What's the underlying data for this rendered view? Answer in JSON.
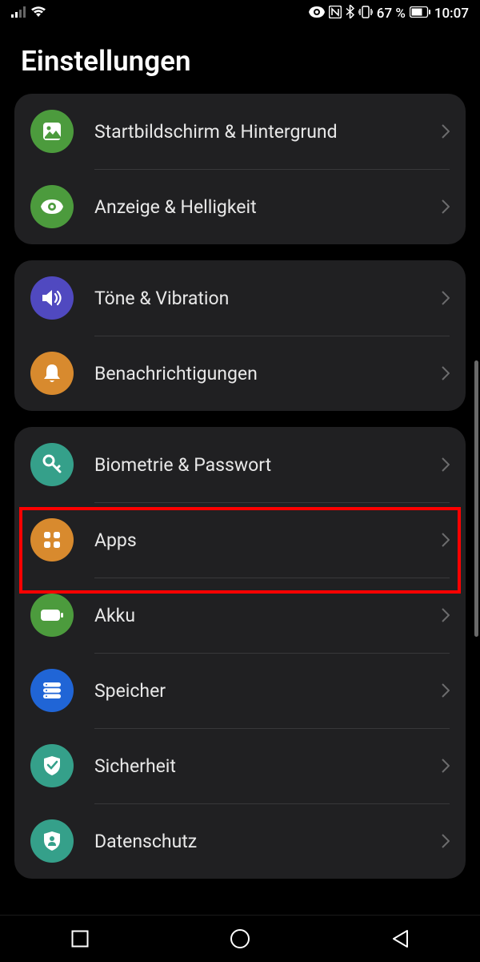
{
  "status": {
    "battery_text": "67 %",
    "time": "10:07"
  },
  "title": "Einstellungen",
  "groups": [
    {
      "items": [
        {
          "id": "home",
          "label": "Startbildschirm & Hintergrund",
          "icon": "image-icon",
          "color": "#4c9b3d"
        },
        {
          "id": "display",
          "label": "Anzeige & Helligkeit",
          "icon": "eye-icon",
          "color": "#4c9b3d"
        }
      ]
    },
    {
      "items": [
        {
          "id": "sound",
          "label": "Töne & Vibration",
          "icon": "volume-icon",
          "color": "#5049c0"
        },
        {
          "id": "notifications",
          "label": "Benachrichtigungen",
          "icon": "bell-icon",
          "color": "#d88a2e"
        }
      ]
    },
    {
      "items": [
        {
          "id": "biometrics",
          "label": "Biometrie & Passwort",
          "icon": "key-icon",
          "color": "#35a08a"
        },
        {
          "id": "apps",
          "label": "Apps",
          "icon": "apps-icon",
          "color": "#d88a2e"
        },
        {
          "id": "battery",
          "label": "Akku",
          "icon": "battery-icon",
          "color": "#4c9b3d"
        },
        {
          "id": "storage",
          "label": "Speicher",
          "icon": "storage-icon",
          "color": "#2065d6"
        },
        {
          "id": "security",
          "label": "Sicherheit",
          "icon": "shield-check-icon",
          "color": "#35a08a"
        },
        {
          "id": "privacy",
          "label": "Datenschutz",
          "icon": "privacy-icon",
          "color": "#35a08a"
        }
      ]
    }
  ],
  "highlighted_item_id": "apps"
}
